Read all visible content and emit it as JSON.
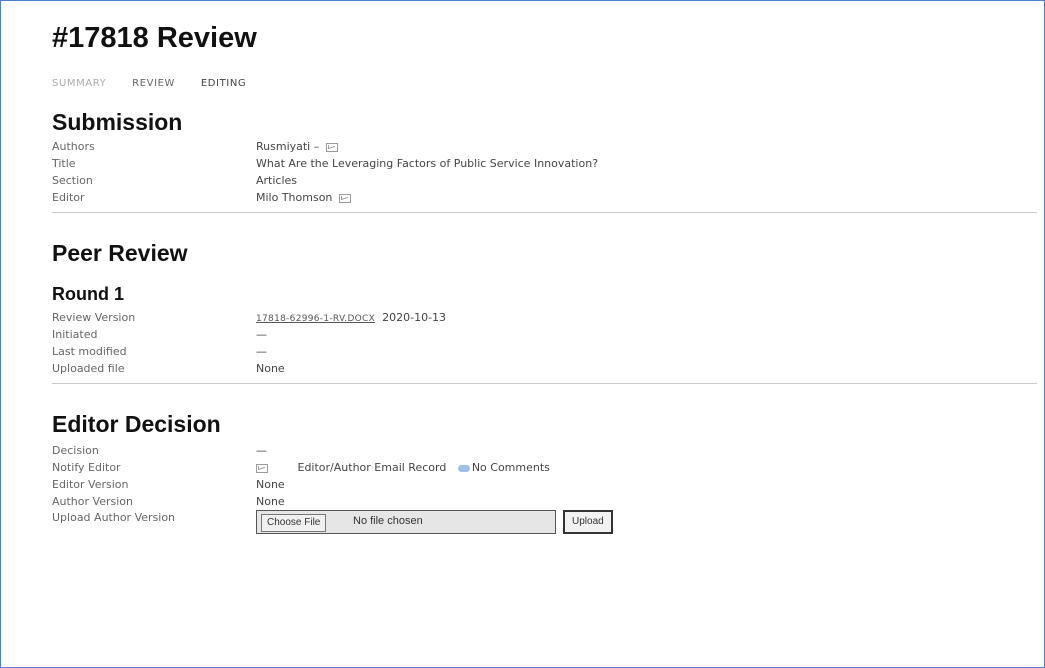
{
  "page_title": "#17818 Review",
  "tabs": [
    "Summary",
    "Review",
    "Editing"
  ],
  "submission": {
    "heading": "Submission",
    "rows": [
      {
        "label": "Authors",
        "value": "Rusmiyati",
        "suffix": " –",
        "icon": "envelope-icon"
      },
      {
        "label": "Title",
        "value": "What Are the Leveraging Factors of Public Service Innovation?"
      },
      {
        "label": "Section",
        "value": "Articles"
      },
      {
        "label": "Editor",
        "value": "Milo Thomson",
        "icon": "envelope-icon"
      }
    ]
  },
  "peer_review": {
    "heading": "Peer Review",
    "round_heading": "Round 1",
    "rows": [
      {
        "label": "Review Version",
        "file": "17818-62996-1-RV.DOCX",
        "date": "2020-10-13"
      },
      {
        "label": "Initiated",
        "value": "—"
      },
      {
        "label": "Last modified",
        "value": "—"
      },
      {
        "label": "Uploaded file",
        "value": "None"
      }
    ]
  },
  "editor_decision": {
    "heading": "Editor Decision",
    "decision_label": "Decision",
    "decision_value": "—",
    "notify_label": "Notify Editor",
    "email_record": "Editor/Author Email Record",
    "comments": "No Comments",
    "editor_version_label": "Editor Version",
    "editor_version_value": "None",
    "author_version_label": "Author Version",
    "author_version_value": "None",
    "upload_label": "Upload Author Version",
    "choose_file": "Choose File",
    "no_file": "No file chosen",
    "upload_button": "Upload"
  },
  "colors": {
    "frame_border": "#4f7fd0",
    "comment_bubble": "#9fc0e6"
  }
}
